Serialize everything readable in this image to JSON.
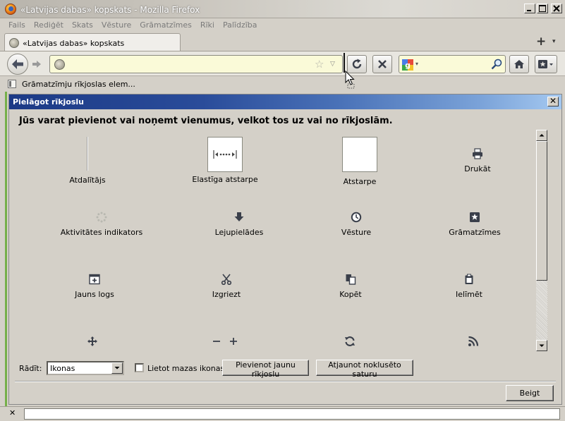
{
  "window": {
    "title": "«Latvijas dabas» kopskats - Mozilla Firefox"
  },
  "menubar": {
    "items": [
      "Fails",
      "Rediģēt",
      "Skats",
      "Vēsture",
      "Grāmatzīmes",
      "Rīki",
      "Palīdzība"
    ]
  },
  "tabs": {
    "active_label": "«Latvijas dabas» kopskats",
    "new_tab_symbol": "+",
    "list_symbol": "▾"
  },
  "navbar": {
    "url_value": "",
    "search_value": "",
    "star_symbol": "☆",
    "dropdown_symbol": "▽",
    "stop_symbol": "✕"
  },
  "bookmarks": {
    "toolbar_item_label": "Grāmatzīmju rīkjoslas elem..."
  },
  "dialog": {
    "title": "Pielāgot rīkjoslu",
    "close_symbol": "✕",
    "instruction": "Jūs varat pievienot vai noņemt vienumus, velkot tos uz vai no rīkjoslām.",
    "palette": [
      {
        "label": "Atdalītājs",
        "icon": "separator-icon"
      },
      {
        "label": "Elastīga atstarpe",
        "icon": "flexible-space-icon"
      },
      {
        "label": "Atstarpe",
        "icon": "space-icon"
      },
      {
        "label": "Drukāt",
        "icon": "print-icon"
      },
      {
        "label": "Aktivitātes indikators",
        "icon": "throbber-icon"
      },
      {
        "label": "Lejupielādes",
        "icon": "downloads-icon"
      },
      {
        "label": "Vēsture",
        "icon": "history-icon"
      },
      {
        "label": "Grāmatzīmes",
        "icon": "bookmarks-icon"
      },
      {
        "label": "Jauns logs",
        "icon": "new-window-icon"
      },
      {
        "label": "Izgriezt",
        "icon": "cut-icon"
      },
      {
        "label": "Kopēt",
        "icon": "copy-icon"
      },
      {
        "label": "Ielīmēt",
        "icon": "paste-icon"
      },
      {
        "label": "",
        "icon": "fullscreen-icon"
      },
      {
        "label": "",
        "icon": "zoom-controls-icon"
      },
      {
        "label": "",
        "icon": "sync-icon"
      },
      {
        "label": "",
        "icon": "feed-icon"
      }
    ],
    "show_label": "Rādīt:",
    "show_value": "Ikonas",
    "small_icons_label": "Lietot mazas ikonas",
    "small_icons_checked": false,
    "add_toolbar_label": "Pievienot jaunu rīkjoslu",
    "restore_label": "Atjaunot noklusēto saturu",
    "done_label": "Beigt"
  },
  "findbar": {
    "close_symbol": "✕",
    "value": ""
  },
  "colors": {
    "accent_green": "#76b04a",
    "dialog_title_start": "#1c3a86",
    "dialog_title_end": "#a4c8f0",
    "urlbar_bg": "#fafad8"
  }
}
